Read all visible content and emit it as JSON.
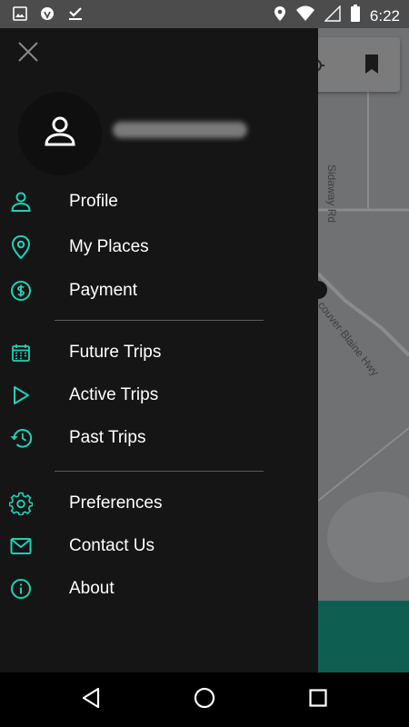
{
  "status_bar": {
    "time": "6:22",
    "left_icons": [
      "image-icon",
      "shield-icon",
      "download-done-icon"
    ],
    "right_icons": [
      "location-icon",
      "wifi-icon",
      "signal-icon",
      "battery-icon"
    ]
  },
  "map": {
    "road_labels": [
      "Sidaway Rd",
      "couver-Blaine Hwy"
    ],
    "accent_bottom": "#0e5f51"
  },
  "drawer": {
    "close_icon": "close-icon",
    "avatar_icon": "person-icon",
    "username": "",
    "sections": [
      {
        "items": [
          {
            "label": "Profile",
            "icon": "person-icon"
          },
          {
            "label": "My Places",
            "icon": "location-pin-icon"
          },
          {
            "label": "Payment",
            "icon": "dollar-icon"
          }
        ]
      },
      {
        "items": [
          {
            "label": "Future Trips",
            "icon": "calendar-icon"
          },
          {
            "label": "Active Trips",
            "icon": "play-icon"
          },
          {
            "label": "Past Trips",
            "icon": "history-icon"
          }
        ]
      },
      {
        "items": [
          {
            "label": "Preferences",
            "icon": "gear-icon"
          },
          {
            "label": "Contact Us",
            "icon": "mail-icon"
          },
          {
            "label": "About",
            "icon": "info-icon"
          }
        ]
      }
    ]
  },
  "colors": {
    "accent": "#1fd1b6",
    "drawer_bg": "#151515",
    "status_bar": "#4c4c4c"
  },
  "nav_bar": {
    "buttons": [
      "back-icon",
      "home-icon",
      "recents-icon"
    ]
  }
}
